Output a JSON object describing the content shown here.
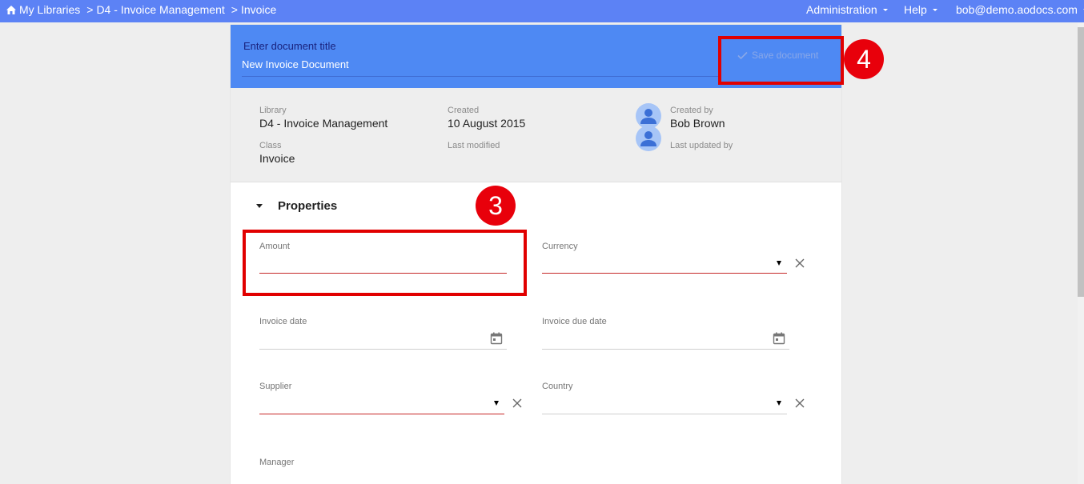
{
  "topbar": {
    "breadcrumbs": [
      "My Libraries",
      "D4 - Invoice Management",
      "Invoice"
    ],
    "separator": ">",
    "menu": {
      "administration": "Administration",
      "help": "Help",
      "user": "bob@demo.aodocs.com"
    }
  },
  "header": {
    "title_label": "Enter document title",
    "title_value": "New Invoice Document",
    "save_label": "Save document"
  },
  "meta": {
    "library_label": "Library",
    "library_value": "D4 - Invoice Management",
    "class_label": "Class",
    "class_value": "Invoice",
    "created_label": "Created",
    "created_value": "10 August 2015",
    "modified_label": "Last modified",
    "created_by_label": "Created by",
    "created_by_value": "Bob Brown",
    "updated_by_label": "Last updated by"
  },
  "properties": {
    "title": "Properties",
    "fields": {
      "amount": "Amount",
      "currency": "Currency",
      "invoice_date": "Invoice date",
      "invoice_due_date": "Invoice due date",
      "supplier": "Supplier",
      "country": "Country",
      "manager": "Manager"
    }
  },
  "annotations": {
    "badge_3": "3",
    "badge_4": "4"
  },
  "colors": {
    "topbar": "#5c82f5",
    "header": "#4e89f3",
    "annotation": "#e10000",
    "required_underline": "#c62828"
  }
}
